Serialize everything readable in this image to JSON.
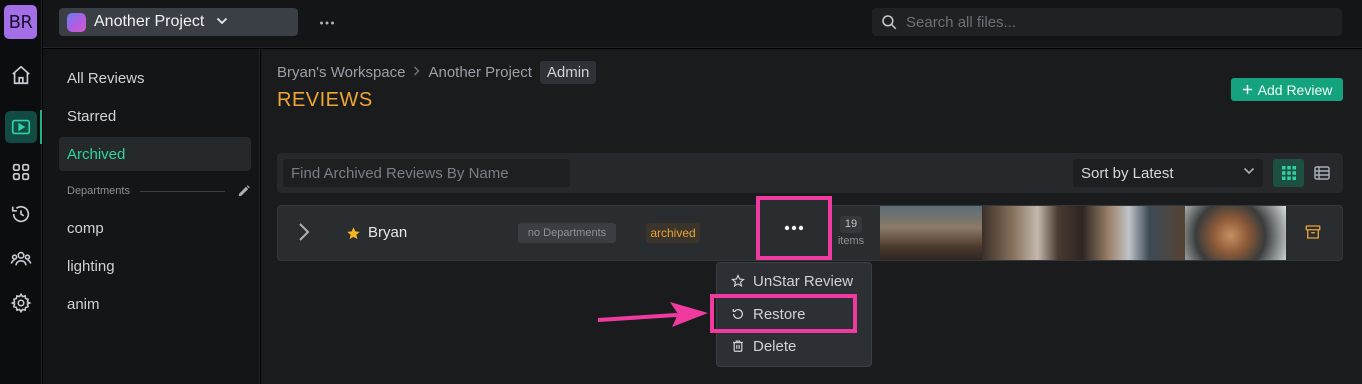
{
  "rail": {
    "avatar_initials": "BR"
  },
  "topbar": {
    "project_name": "Another Project",
    "search_placeholder": "Search all files..."
  },
  "leftnav": {
    "items": [
      {
        "label": "All Reviews"
      },
      {
        "label": "Starred"
      },
      {
        "label": "Archived"
      }
    ],
    "departments_header": "Departments",
    "departments": [
      {
        "label": "comp"
      },
      {
        "label": "lighting"
      },
      {
        "label": "anim"
      }
    ]
  },
  "main": {
    "breadcrumb": [
      "Bryan's Workspace",
      "Another Project",
      "Admin"
    ],
    "title": "REVIEWS",
    "add_button_label": "Add Review",
    "filter_placeholder": "Find Archived Reviews By Name",
    "sort_label": "Sort by Latest"
  },
  "review_row": {
    "name": "Bryan",
    "department_badge": "no Departments",
    "status_badge": "archived",
    "item_count": "19",
    "item_count_label": "items"
  },
  "context_menu": {
    "unstar_label": "UnStar Review",
    "restore_label": "Restore",
    "delete_label": "Delete"
  },
  "colors": {
    "accent_green": "#14a37d",
    "active_nav_text": "#2ed3a4",
    "title_orange": "#f0a534",
    "highlight_pink": "#f13aa0",
    "star_yellow": "#f5b820"
  }
}
